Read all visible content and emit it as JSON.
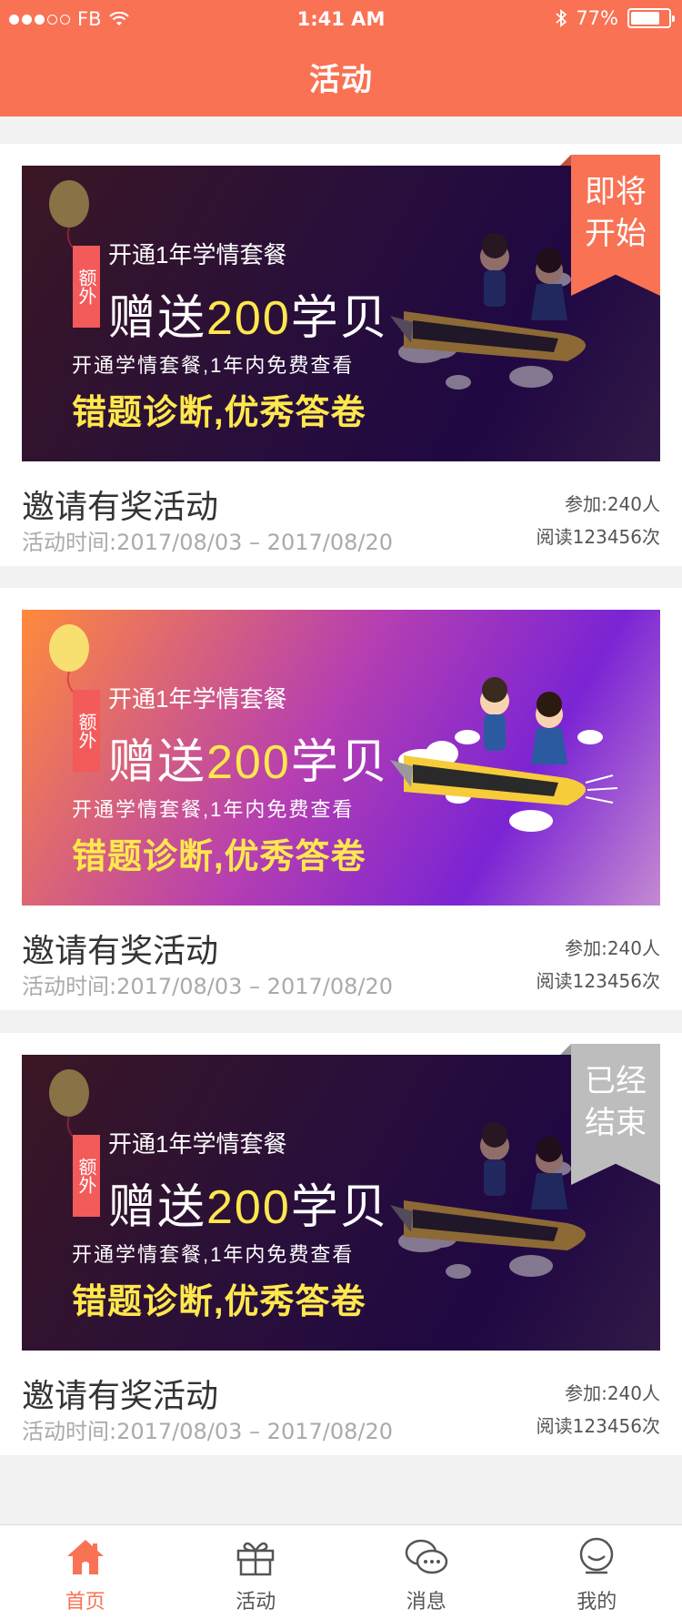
{
  "status_bar": {
    "carrier": "FB",
    "time": "1:41 AM",
    "battery": "77%",
    "battery_level": 0.77,
    "signal_dots_filled": 3,
    "signal_dots_total": 5
  },
  "header": {
    "title": "活动"
  },
  "banner": {
    "tag": "额外",
    "line1": "开通1年学情套餐",
    "line2_prefix": "赠送",
    "line2_number": "200",
    "line2_suffix": "学贝",
    "line3": "开通学情套餐,1年内免费查看",
    "line4": "错题诊断,优秀答卷"
  },
  "activities": [
    {
      "title": "邀请有奖活动",
      "time_label": "活动时间:",
      "time_range": "2017/08/03 – 2017/08/20",
      "join": "参加:240人",
      "read": "阅读123456次",
      "ribbon": "即将开始",
      "ribbon_line1": "即将",
      "ribbon_line2": "开始",
      "ribbon_color": "#f97254"
    },
    {
      "title": "邀请有奖活动",
      "time_label": "活动时间:",
      "time_range": "2017/08/03 – 2017/08/20",
      "join": "参加:240人",
      "read": "阅读123456次",
      "ribbon": ""
    },
    {
      "title": "邀请有奖活动",
      "time_label": "活动时间:",
      "time_range": "2017/08/03 – 2017/08/20",
      "join": "参加:240人",
      "read": "阅读123456次",
      "ribbon": "已经结束",
      "ribbon_line1": "已经",
      "ribbon_line2": "结束",
      "ribbon_color": "#bdbdbd"
    }
  ],
  "tabbar": {
    "items": [
      {
        "label": "首页",
        "icon": "home-icon",
        "active": true
      },
      {
        "label": "活动",
        "icon": "gift-icon",
        "active": false
      },
      {
        "label": "消息",
        "icon": "chat-icon",
        "active": false
      },
      {
        "label": "我的",
        "icon": "user-icon",
        "active": false
      }
    ]
  },
  "colors": {
    "accent": "#f97254",
    "ended": "#bdbdbd"
  }
}
